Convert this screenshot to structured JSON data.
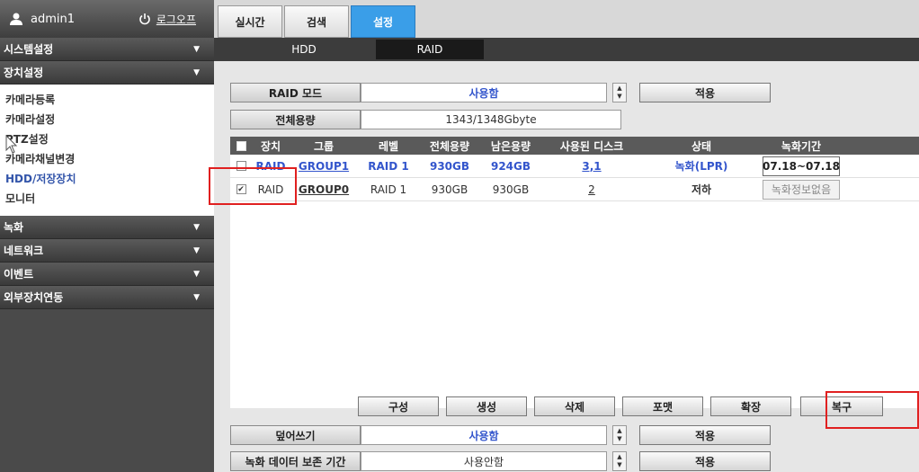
{
  "user": {
    "name": "admin1",
    "logout_label": "로그오프"
  },
  "menu": {
    "sections": [
      {
        "label": "시스템설정"
      },
      {
        "label": "장치설정"
      }
    ],
    "device_items": [
      {
        "label": "카메라등록"
      },
      {
        "label": "카메라설정"
      },
      {
        "label": "PTZ설정"
      },
      {
        "label": "카메라채널변경"
      },
      {
        "label": "HDD/저장장치"
      },
      {
        "label": "모니터"
      }
    ],
    "lower_sections": [
      {
        "label": "녹화"
      },
      {
        "label": "네트워크"
      },
      {
        "label": "이벤트"
      },
      {
        "label": "외부장치연동"
      }
    ]
  },
  "top_tabs": [
    {
      "label": "실시간"
    },
    {
      "label": "검색"
    },
    {
      "label": "설정"
    }
  ],
  "sub_tabs": [
    {
      "label": "HDD"
    },
    {
      "label": "RAID"
    }
  ],
  "raid_mode": {
    "label": "RAID 모드",
    "value": "사용함",
    "apply": "적용"
  },
  "total_capacity": {
    "label": "전체용량",
    "value": "1343/1348Gbyte"
  },
  "table": {
    "headers": [
      "장치",
      "그룹",
      "레벨",
      "전체용량",
      "남은용량",
      "사용된 디스크",
      "상태",
      "녹화기간"
    ],
    "rows": [
      {
        "device": "RAID",
        "group": "GROUP1",
        "level": "RAID 1",
        "total": "930GB",
        "free": "924GB",
        "disks": "3,1",
        "status": "녹화(LPR)",
        "period": "07.18~07.18",
        "checked": ""
      },
      {
        "device": "RAID",
        "group": "GROUP0",
        "level": "RAID 1",
        "total": "930GB",
        "free": "930GB",
        "disks": "2",
        "status": "저하",
        "period": "녹화정보없음",
        "checked": "✔"
      }
    ]
  },
  "actions": {
    "configure": "구성",
    "create": "생성",
    "delete": "삭제",
    "format": "포맷",
    "expand": "확장",
    "recover": "복구"
  },
  "overwrite": {
    "label": "덮어쓰기",
    "value": "사용함",
    "apply": "적용"
  },
  "retention": {
    "label": "녹화 데이터 보존 기간",
    "value": "사용안함",
    "apply": "적용"
  },
  "colors": {
    "accent": "#3a9ee8",
    "highlight": "#e02020"
  }
}
